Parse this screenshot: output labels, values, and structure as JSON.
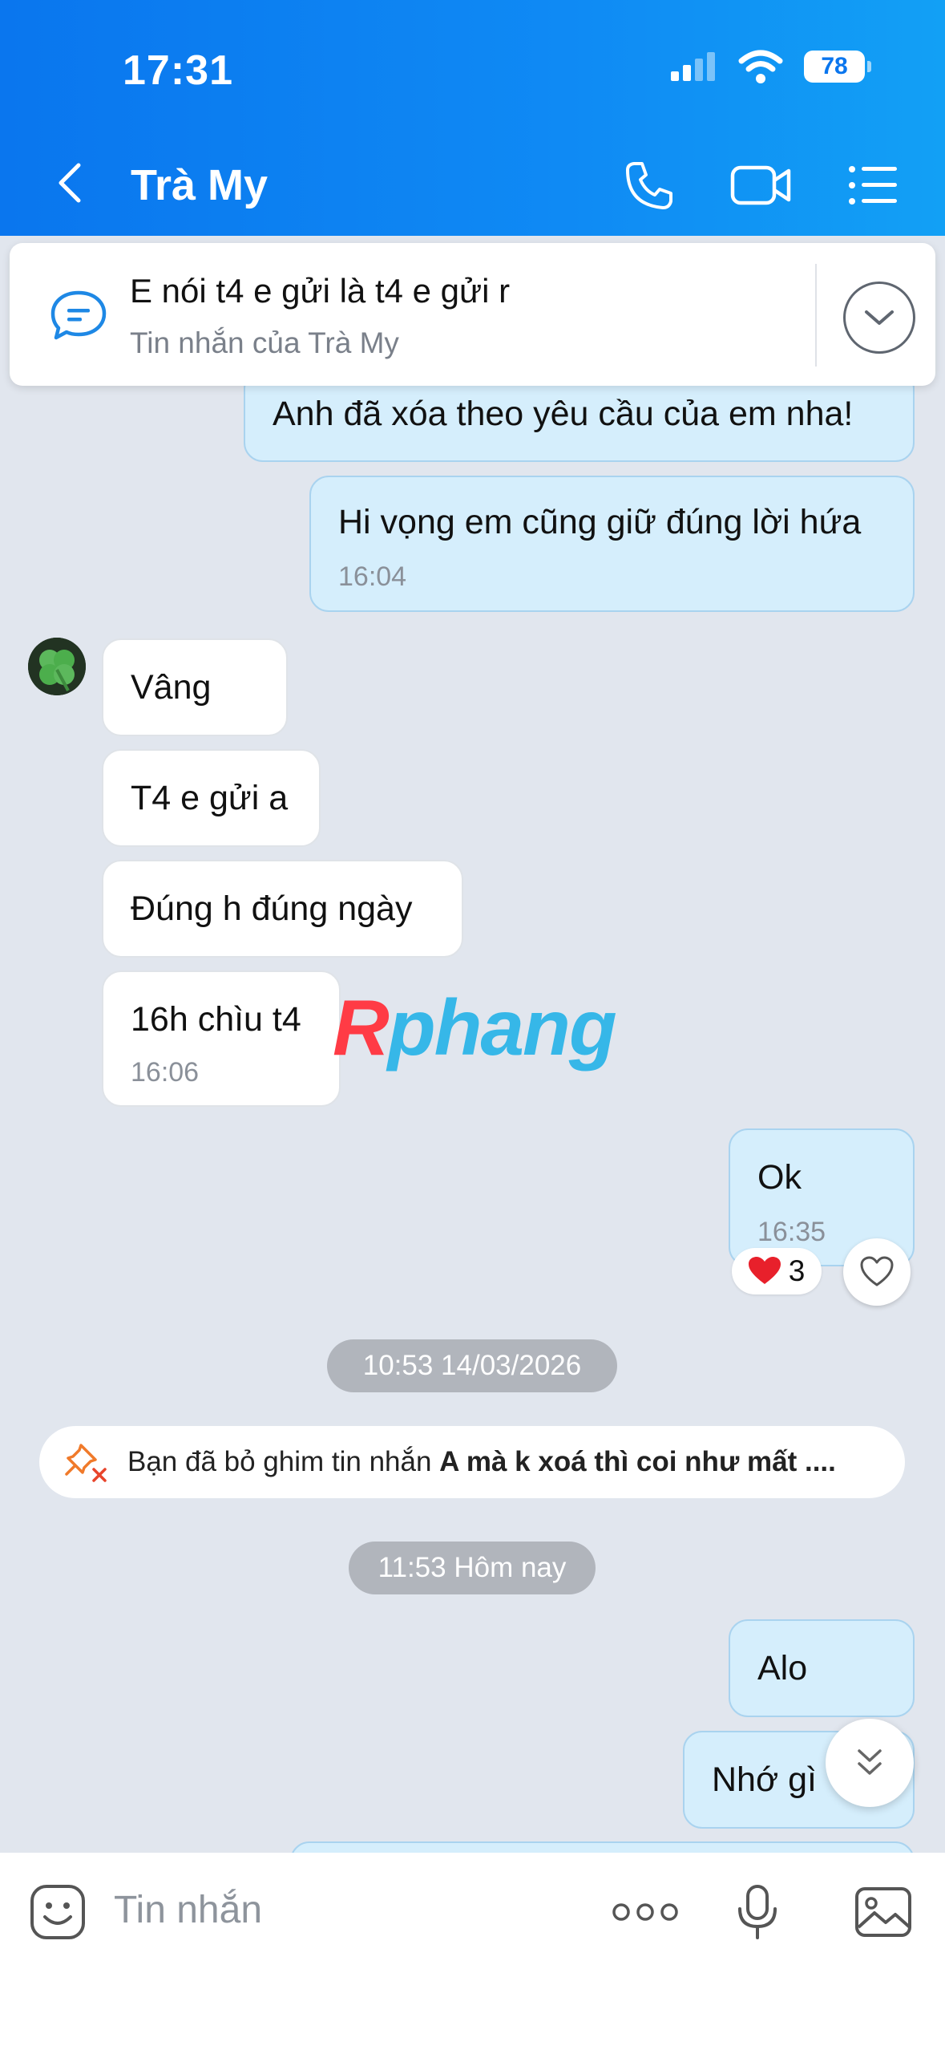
{
  "status_bar": {
    "time": "17:31",
    "battery": "78"
  },
  "header": {
    "contact_name": "Trà My"
  },
  "pinned": {
    "title": "E nói t4 e gửi là t4 e gửi r",
    "subtitle": "Tin nhắn của Trà My"
  },
  "messages": [
    {
      "side": "me",
      "text": "Anh đã xóa theo yêu cầu của em nha!"
    },
    {
      "side": "me",
      "text": "Hi vọng em cũng giữ đúng lời hứa",
      "time": "16:04"
    },
    {
      "side": "them",
      "text": "Vâng"
    },
    {
      "side": "them",
      "text": "T4 e gửi a"
    },
    {
      "side": "them",
      "text": "Đúng h đúng ngày"
    },
    {
      "side": "them",
      "text": "16h chìu t4",
      "time": "16:06"
    },
    {
      "side": "me",
      "text": "Ok",
      "time": "16:35",
      "reaction_count": "3"
    },
    {
      "side": "me",
      "text": "Alo"
    },
    {
      "side": "me",
      "text": "Nhớ gì"
    }
  ],
  "watermark": {
    "prefix": "R",
    "rest": "phang"
  },
  "date_separators": [
    "10:53 14/03/2026",
    "11:53 Hôm nay"
  ],
  "system_notice": {
    "prefix": "Bạn đã bỏ ghim tin nhắn ",
    "bold": "A mà k xoá thì coi như mất ...."
  },
  "input": {
    "placeholder": "Tin nhắn"
  },
  "colors": {
    "header": "#0a76ee",
    "my_bubble": "#d5eefc",
    "their_bubble": "#ffffff",
    "background": "#e1e6ee"
  }
}
